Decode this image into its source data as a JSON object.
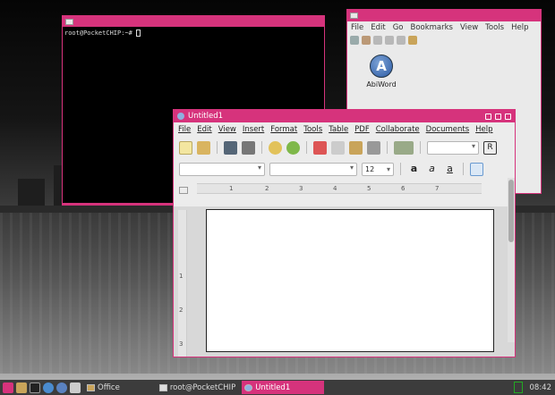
{
  "terminal": {
    "prompt": "root@PocketCHIP:~#"
  },
  "file_manager": {
    "menu": [
      "File",
      "Edit",
      "Go",
      "Bookmarks",
      "View",
      "Tools",
      "Help"
    ],
    "launcher_label": "AbiWord"
  },
  "abiword": {
    "title": "Untitled1",
    "menu": [
      "File",
      "Edit",
      "View",
      "Insert",
      "Format",
      "Tools",
      "Table",
      "PDF",
      "Collaborate",
      "Documents",
      "Help"
    ],
    "font_size": "12",
    "ruler_numbers": [
      "1",
      "2",
      "3",
      "4",
      "5",
      "6",
      "7"
    ],
    "vruler_numbers": [
      "1",
      "2",
      "3"
    ],
    "ruler_box": "R"
  },
  "taskbar": {
    "office_label": "Office",
    "terminal_task": "root@PocketCHIP",
    "abiword_task": "Untitled1",
    "clock": "08:42"
  },
  "colors": {
    "accent": "#d6337c",
    "taskbar": "#3c3c3c"
  }
}
